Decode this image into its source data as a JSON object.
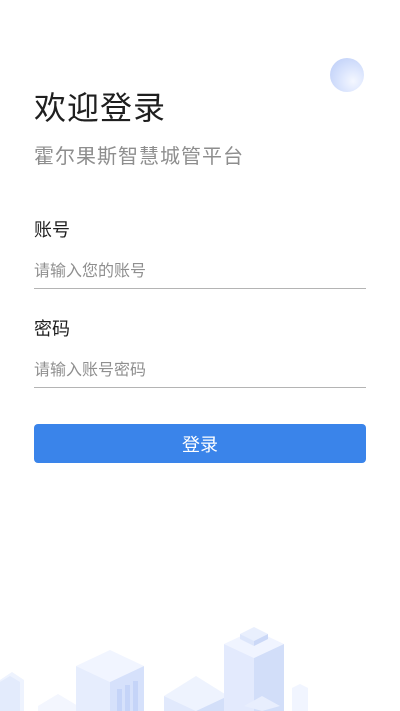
{
  "login": {
    "title": "欢迎登录",
    "subtitle": "霍尔果斯智慧城管平台",
    "account_label": "账号",
    "account_placeholder": "请输入您的账号",
    "password_label": "密码",
    "password_placeholder": "请输入账号密码",
    "submit_label": "登录"
  },
  "colors": {
    "accent": "#3a84ea",
    "title_text": "#1f1f1f",
    "subtitle_text": "#8e8e8e",
    "input_underline": "#b4b4b4"
  },
  "decorations": {
    "top_orb": "gradient-orb",
    "footer": "city-skyline-illustration"
  }
}
